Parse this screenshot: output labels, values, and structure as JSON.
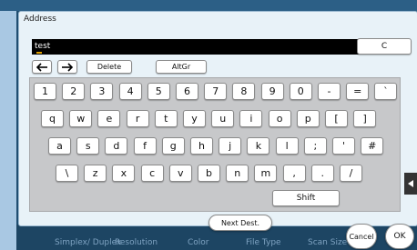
{
  "dialog": {
    "title": "Address"
  },
  "input": {
    "value": "test"
  },
  "buttons": {
    "clear": "C",
    "delete": "Delete",
    "altgr": "AltGr",
    "shift": "Shift",
    "next_dest": "Next Dest.",
    "cancel": "Cancel",
    "ok": "OK"
  },
  "keys": {
    "row1": [
      "1",
      "2",
      "3",
      "4",
      "5",
      "6",
      "7",
      "8",
      "9",
      "0",
      "-",
      "=",
      "`"
    ],
    "row2": [
      "q",
      "w",
      "e",
      "r",
      "t",
      "y",
      "u",
      "i",
      "o",
      "p",
      "[",
      "]"
    ],
    "row3": [
      "a",
      "s",
      "d",
      "f",
      "g",
      "h",
      "j",
      "k",
      "l",
      ";",
      "'",
      "#"
    ],
    "row4": [
      "\\",
      "z",
      "x",
      "c",
      "v",
      "b",
      "n",
      "m",
      ",",
      ".",
      "/"
    ]
  },
  "background": {
    "labels": [
      "Simplex/\nDuplex",
      "Resolution",
      "Color",
      "File Type",
      "Scan Size"
    ]
  },
  "colors": {
    "dialog_bg": "#e8f2f8",
    "keyboard_bg": "#c7c8ca",
    "background": "#1f4d70"
  }
}
